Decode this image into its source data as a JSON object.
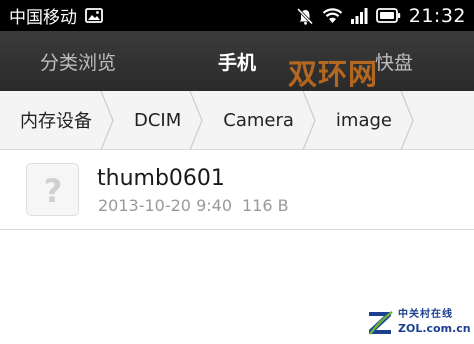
{
  "status_bar": {
    "carrier": "中国移动",
    "clock": "21:32",
    "icons": [
      "image-notification-icon",
      "silent-mode-icon",
      "wifi-icon",
      "signal-icon",
      "battery-icon"
    ]
  },
  "tabs": [
    {
      "label": "分类浏览",
      "active": false
    },
    {
      "label": "手机",
      "active": true
    },
    {
      "label": "快盘",
      "active": false
    }
  ],
  "watermark_top": "双环网",
  "breadcrumb": [
    {
      "label": "内存设备"
    },
    {
      "label": "DCIM"
    },
    {
      "label": "Camera"
    },
    {
      "label": "image"
    }
  ],
  "files": [
    {
      "name": "thumb0601",
      "date": "2013-10-20 9:40",
      "size": "116 B",
      "icon": "unknown-file-icon"
    }
  ],
  "watermark_bottom": {
    "cn": "中关村在线",
    "en": "ZOL.com.cn"
  },
  "colors": {
    "status_bar": "#000000",
    "tab_bar": "#333333",
    "active_tab": "#ffffff",
    "inactive_tab": "#bdbdbd",
    "breadcrumb_bg": "#f4f4f4",
    "meta_text": "#9a9a9a",
    "watermark": "#e07a1c",
    "zol_blue": "#1c3f8f",
    "zol_green": "#6db33f"
  }
}
